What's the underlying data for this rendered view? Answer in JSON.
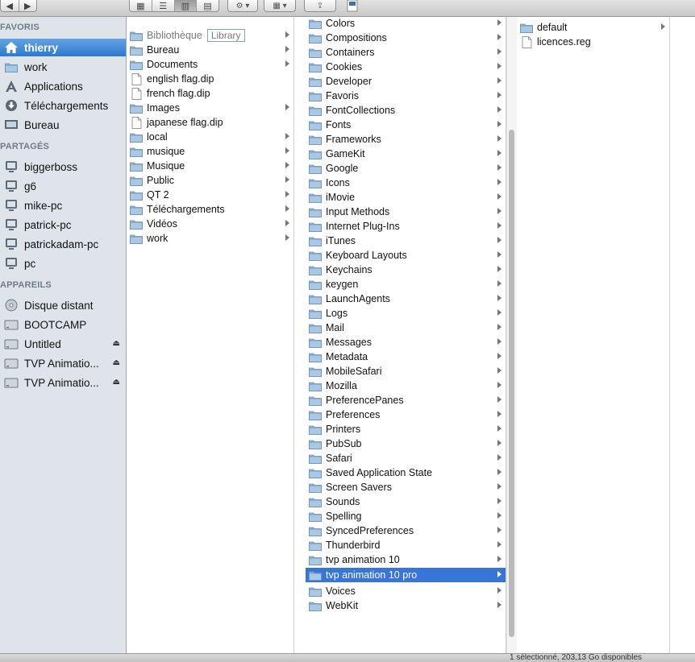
{
  "sidebar": {
    "sections": [
      {
        "header": "FAVORIS",
        "items": [
          {
            "label": "thierry",
            "icon": "home-icon",
            "selected": true
          },
          {
            "label": "work",
            "icon": "folder-icon"
          },
          {
            "label": "Applications",
            "icon": "applications-icon"
          },
          {
            "label": "Téléchargements",
            "icon": "download-icon"
          },
          {
            "label": "Bureau",
            "icon": "desktop-folder-icon"
          }
        ]
      },
      {
        "header": "PARTAGÉS",
        "items": [
          {
            "label": "biggerboss",
            "icon": "computer-icon"
          },
          {
            "label": "g6",
            "icon": "computer-icon"
          },
          {
            "label": "mike-pc",
            "icon": "computer-icon"
          },
          {
            "label": "patrick-pc",
            "icon": "computer-icon"
          },
          {
            "label": "patrickadam-pc",
            "icon": "computer-icon"
          },
          {
            "label": "pc",
            "icon": "computer-icon"
          }
        ]
      },
      {
        "header": "APPAREILS",
        "items": [
          {
            "label": "Disque distant",
            "icon": "disc-icon"
          },
          {
            "label": "BOOTCAMP",
            "icon": "drive-icon"
          },
          {
            "label": "Untitled",
            "icon": "drive-icon",
            "eject": true
          },
          {
            "label": "TVP Animatio...",
            "icon": "drive-icon",
            "eject": true
          },
          {
            "label": "TVP Animatio...",
            "icon": "drive-icon",
            "eject": true
          }
        ]
      }
    ]
  },
  "column1": {
    "items": [
      {
        "label": "Bibliothèque",
        "tag": "Library",
        "type": "folder",
        "arrow": true,
        "dim": true
      },
      {
        "label": "Bureau",
        "type": "folder",
        "arrow": true
      },
      {
        "label": "Documents",
        "type": "folder",
        "arrow": true
      },
      {
        "label": "english flag.dip",
        "type": "file"
      },
      {
        "label": "french flag.dip",
        "type": "file"
      },
      {
        "label": "Images",
        "type": "folder",
        "arrow": true
      },
      {
        "label": "japanese flag.dip",
        "type": "file"
      },
      {
        "label": "local",
        "type": "folder",
        "arrow": true
      },
      {
        "label": "musique",
        "type": "folder",
        "arrow": true
      },
      {
        "label": "Musique",
        "type": "folder",
        "arrow": true
      },
      {
        "label": "Public",
        "type": "folder",
        "arrow": true
      },
      {
        "label": "QT 2",
        "type": "folder",
        "arrow": true
      },
      {
        "label": "Téléchargements",
        "type": "folder",
        "arrow": true
      },
      {
        "label": "Vidéos",
        "type": "folder",
        "arrow": true
      },
      {
        "label": "work",
        "type": "folder",
        "arrow": true
      }
    ]
  },
  "column2": {
    "items": [
      {
        "label": "Colors",
        "arrow": true
      },
      {
        "label": "Compositions",
        "arrow": true
      },
      {
        "label": "Containers",
        "arrow": true
      },
      {
        "label": "Cookies",
        "arrow": true
      },
      {
        "label": "Developer",
        "arrow": true
      },
      {
        "label": "Favoris",
        "arrow": true
      },
      {
        "label": "FontCollections",
        "arrow": true
      },
      {
        "label": "Fonts",
        "arrow": true
      },
      {
        "label": "Frameworks",
        "arrow": true
      },
      {
        "label": "GameKit",
        "arrow": true
      },
      {
        "label": "Google",
        "arrow": true
      },
      {
        "label": "Icons",
        "arrow": true
      },
      {
        "label": "iMovie",
        "arrow": true
      },
      {
        "label": "Input Methods",
        "arrow": true
      },
      {
        "label": "Internet Plug-Ins",
        "arrow": true
      },
      {
        "label": "iTunes",
        "arrow": true
      },
      {
        "label": "Keyboard Layouts",
        "arrow": true
      },
      {
        "label": "Keychains",
        "arrow": true
      },
      {
        "label": "keygen",
        "arrow": true
      },
      {
        "label": "LaunchAgents",
        "arrow": true
      },
      {
        "label": "Logs",
        "arrow": true
      },
      {
        "label": "Mail",
        "arrow": true
      },
      {
        "label": "Messages",
        "arrow": true
      },
      {
        "label": "Metadata",
        "arrow": true
      },
      {
        "label": "MobileSafari",
        "arrow": true
      },
      {
        "label": "Mozilla",
        "arrow": true
      },
      {
        "label": "PreferencePanes",
        "arrow": true
      },
      {
        "label": "Preferences",
        "arrow": true
      },
      {
        "label": "Printers",
        "arrow": true
      },
      {
        "label": "PubSub",
        "arrow": true
      },
      {
        "label": "Safari",
        "arrow": true
      },
      {
        "label": "Saved Application State",
        "arrow": true
      },
      {
        "label": "Screen Savers",
        "arrow": true
      },
      {
        "label": "Sounds",
        "arrow": true
      },
      {
        "label": "Spelling",
        "arrow": true
      },
      {
        "label": "SyncedPreferences",
        "arrow": true
      },
      {
        "label": "Thunderbird",
        "arrow": true
      },
      {
        "label": "tvp animation 10",
        "arrow": true
      },
      {
        "label": "tvp animation 10 pro",
        "arrow": true,
        "selected": true
      },
      {
        "label": "Voices",
        "arrow": true
      },
      {
        "label": "WebKit",
        "arrow": true
      }
    ]
  },
  "column3": {
    "items": [
      {
        "label": "default",
        "type": "folder",
        "arrow": true
      },
      {
        "label": "licences.reg",
        "type": "file"
      }
    ]
  },
  "status": {
    "text": "1 sélectionné, 203,13 Go disponibles"
  },
  "colors": {
    "selection": "#3875d7",
    "sidebar_bg": "#dfe4ea",
    "folder": "#8fb4d9"
  }
}
